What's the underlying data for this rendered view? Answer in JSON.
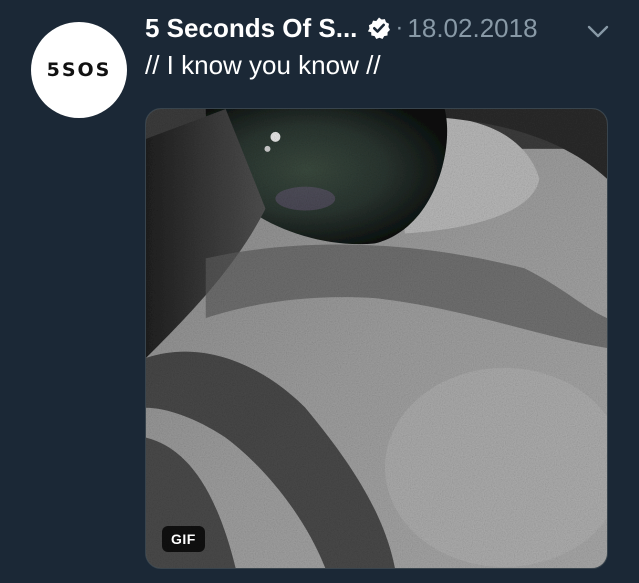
{
  "tweet": {
    "avatar_text": "5SOS",
    "display_name": "5 Seconds Of S...",
    "separator": "·",
    "timestamp": "18.02.2018",
    "verified_icon": "verified-badge-icon",
    "menu_icon": "chevron-down-icon",
    "text": "// I know you know //",
    "media": {
      "type": "gif",
      "badge": "GIF",
      "description_icon": "eye-closeup-image"
    }
  },
  "colors": {
    "background": "#1b2836",
    "text_primary": "#ffffff",
    "text_secondary": "#8899a6",
    "border": "#38444d"
  }
}
